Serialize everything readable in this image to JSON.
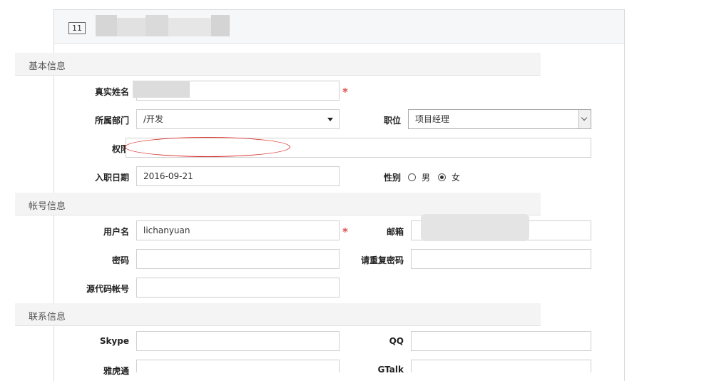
{
  "header": {
    "record_id": "11"
  },
  "sections": {
    "basic": "基本信息",
    "account": "帐号信息",
    "contact": "联系信息"
  },
  "fields": {
    "real_name": {
      "label": "真实姓名",
      "value": ""
    },
    "department": {
      "label": "所属部门",
      "value": "/开发"
    },
    "position": {
      "label": "职位",
      "value": "项目经理"
    },
    "permission": {
      "label": "权限",
      "value": ""
    },
    "join_date": {
      "label": "入职日期",
      "value": "2016-09-21"
    },
    "gender": {
      "label": "性别",
      "options": [
        "男",
        "女"
      ],
      "selected": "女"
    },
    "username": {
      "label": "用户名",
      "value": "lichanyuan"
    },
    "email": {
      "label": "邮箱",
      "value": ""
    },
    "password": {
      "label": "密码",
      "value": ""
    },
    "confirm_password": {
      "label": "请重复密码",
      "value": ""
    },
    "source_account": {
      "label": "源代码帐号",
      "value": ""
    },
    "skype": {
      "label": "Skype",
      "value": ""
    },
    "qq": {
      "label": "QQ",
      "value": ""
    },
    "yixin": {
      "label": "雅虎通",
      "value": ""
    },
    "gtalk": {
      "label": "GTalk",
      "value": ""
    }
  },
  "required_mark": "*"
}
